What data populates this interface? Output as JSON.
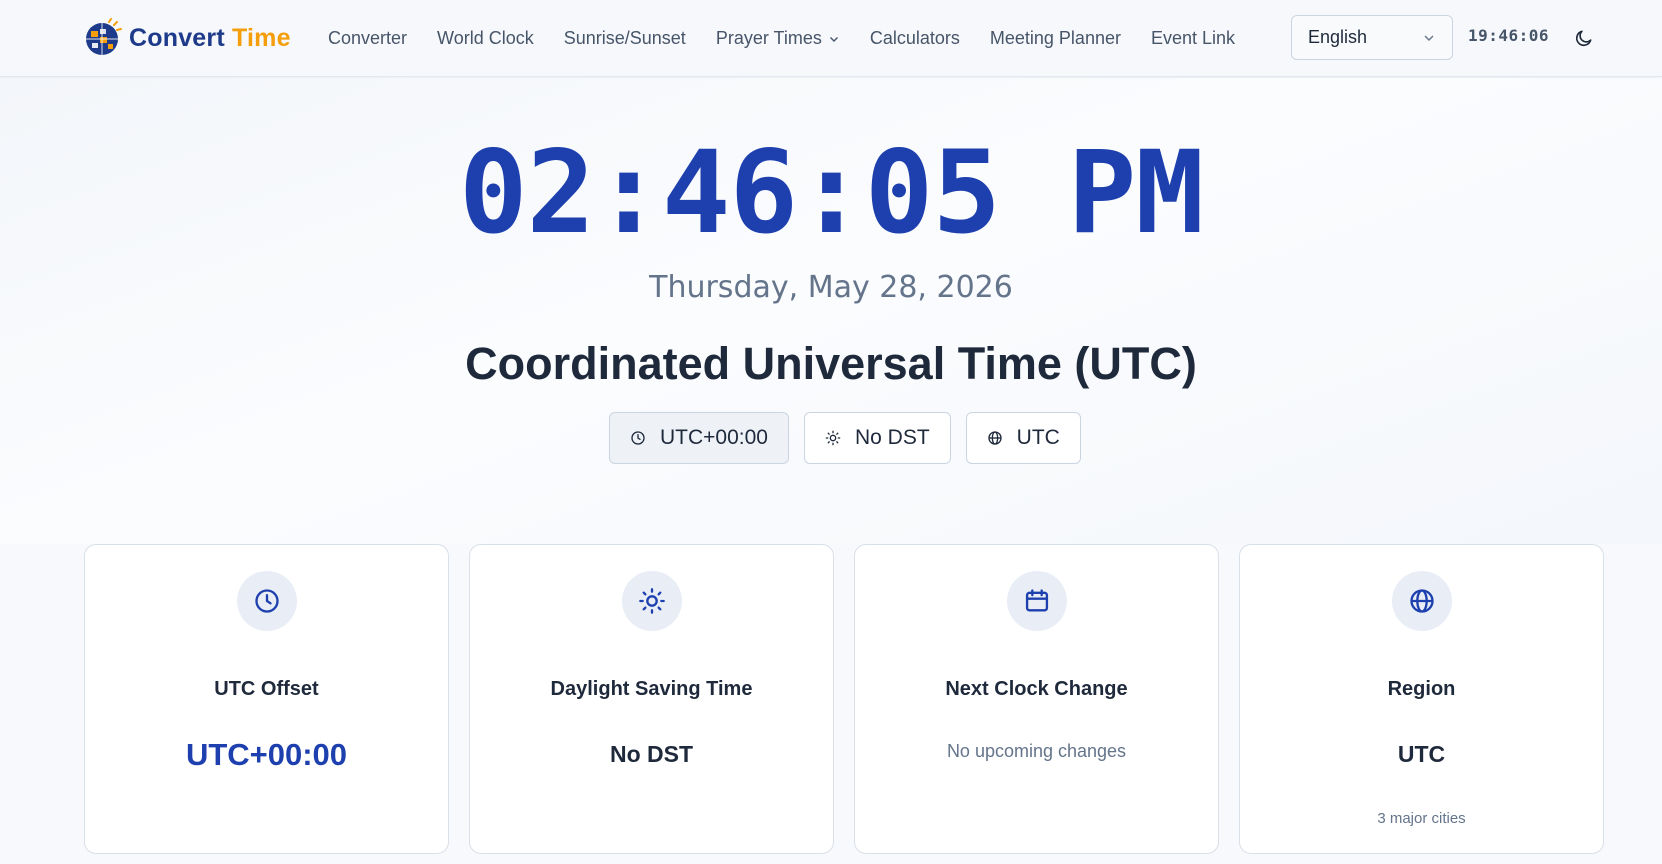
{
  "brand": {
    "name_part1": "Convert",
    "name_part2": " Time"
  },
  "nav": {
    "items": [
      {
        "label": "Converter"
      },
      {
        "label": "World Clock"
      },
      {
        "label": "Sunrise/Sunset"
      },
      {
        "label": "Prayer Times",
        "has_dropdown": true
      },
      {
        "label": "Calculators"
      },
      {
        "label": "Meeting Planner"
      },
      {
        "label": "Event Link"
      }
    ]
  },
  "language": {
    "selected": "English"
  },
  "header_clock": "19:46:06",
  "icons": {
    "theme_toggle": "moon-icon",
    "offset": "clock-icon",
    "dst": "sun-icon",
    "next_change": "calendar-icon",
    "region": "globe-icon"
  },
  "hero": {
    "time": "02:46:05 PM",
    "date": "Thursday, May 28, 2026",
    "timezone_name": "Coordinated Universal Time (UTC)",
    "chips": [
      {
        "label": "UTC+00:00"
      },
      {
        "label": "No DST"
      },
      {
        "label": "UTC"
      }
    ]
  },
  "cards": [
    {
      "title": "UTC Offset",
      "value": "UTC+00:00"
    },
    {
      "title": "Daylight Saving Time",
      "value": "No DST"
    },
    {
      "title": "Next Clock Change",
      "value": "No upcoming changes"
    },
    {
      "title": "Region",
      "value": "UTC",
      "sub": "3 major cities"
    }
  ],
  "colors": {
    "primary": "#1e40af",
    "brand_dark": "#1e3a8a",
    "brand_accent": "#f59e0b",
    "text": "#1e293b",
    "muted": "#64748b"
  }
}
